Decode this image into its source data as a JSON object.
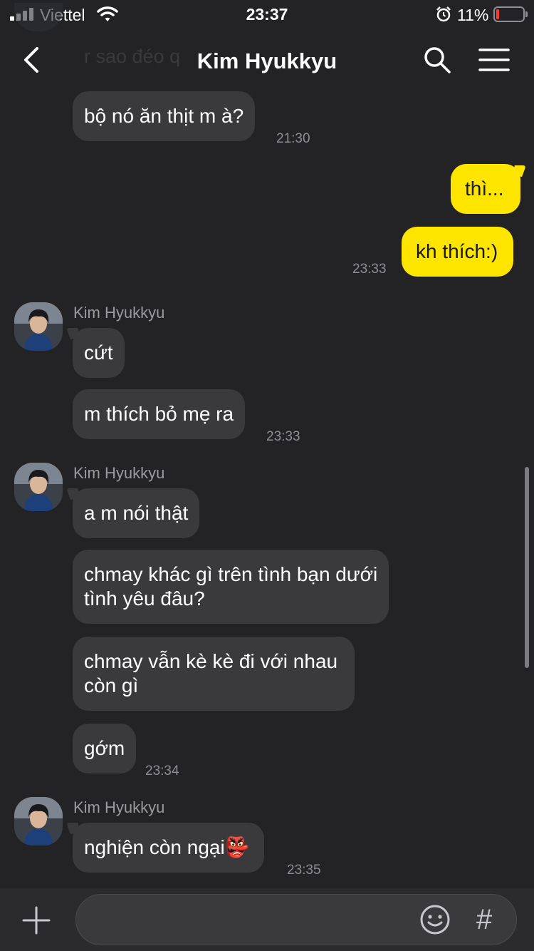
{
  "status_bar": {
    "carrier": "Viettel",
    "time": "23:37",
    "battery_percent": "11%",
    "battery_level": 0.11,
    "battery_color": "#ff3b30"
  },
  "header": {
    "title": "Kim Hyukkyu",
    "ghost_text": "r sao đéo q"
  },
  "colors": {
    "background": "#232325",
    "incoming_bubble": "#3a3a3c",
    "outgoing_bubble": "#fee500",
    "timestamp": "#8e8e93"
  },
  "messages": [
    {
      "text": "bộ nó ăn thịt m à?",
      "time": "21:30"
    },
    {
      "text": "thì..."
    },
    {
      "text": "kh thích:)",
      "time": "23:33"
    },
    {
      "sender": "Kim Hyukkyu"
    },
    {
      "text": "cứt"
    },
    {
      "text": "m thích bỏ mẹ ra",
      "time": "23:33"
    },
    {
      "sender": "Kim Hyukkyu"
    },
    {
      "text": "a m nói thật"
    },
    {
      "text": "chmay khác gì trên tình bạn dưới\ntình yêu đâu?"
    },
    {
      "text": "chmay vẫn kè kè đi với nhau\ncòn gì"
    },
    {
      "text": "gớm",
      "time": "23:34"
    },
    {
      "sender": "Kim Hyukkyu"
    },
    {
      "text": "nghiện còn ngại",
      "emoji": "👺",
      "time": "23:35"
    }
  ],
  "icons": {
    "back": "chevron-left-icon",
    "search": "search-icon",
    "menu": "hamburger-menu-icon",
    "plus": "plus-icon",
    "emoji": "emoji-icon",
    "hashtag": "#"
  }
}
